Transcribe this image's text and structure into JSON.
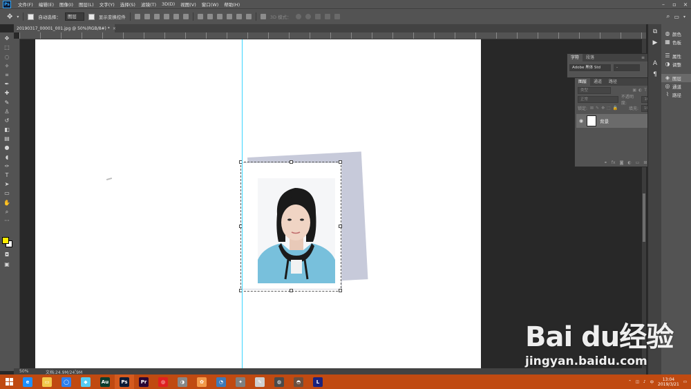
{
  "menu": {
    "logo": "Ps",
    "items": [
      "文件(F)",
      "编辑(E)",
      "图像(I)",
      "图层(L)",
      "文字(Y)",
      "选择(S)",
      "滤镜(T)",
      "3D(D)",
      "视图(V)",
      "窗口(W)",
      "帮助(H)"
    ]
  },
  "options": {
    "auto_select_label": "自动选择：",
    "auto_select_value": "图层",
    "show_transform_label": "显示变换控件",
    "mode_3d_label": "3D 模式："
  },
  "document": {
    "tab_title": "20190317_00001_001.jpg @ 50%(RGB/8#) *",
    "close_glyph": "×"
  },
  "status": {
    "zoom": "50%",
    "doc_size": "文档:24.9M/24.9M"
  },
  "char_panel": {
    "tabs": [
      "字符",
      "段落"
    ],
    "font_family": "Adobe 黑体 Std",
    "font_style": "-"
  },
  "layers_panel": {
    "tabs": [
      "图层",
      "通道",
      "路径"
    ],
    "filter_kind": "类型",
    "blend_mode": "正常",
    "opacity_label": "不透明度:",
    "opacity_value": "100%",
    "lock_label": "锁定:",
    "fill_label": "填充:",
    "fill_value": "100%",
    "layer_name": "背景"
  },
  "dock": {
    "items": [
      {
        "icon": "color-icon",
        "label": "颜色"
      },
      {
        "icon": "swatches-icon",
        "label": "色板"
      },
      {
        "icon": "properties-icon",
        "label": "属性"
      },
      {
        "icon": "adjustments-icon",
        "label": "调整"
      },
      {
        "icon": "layers-icon",
        "label": "图层"
      },
      {
        "icon": "channels-icon",
        "label": "通道"
      },
      {
        "icon": "paths-icon",
        "label": "路径"
      }
    ]
  },
  "taskbar": {
    "apps": [
      {
        "icon": "ie-icon",
        "label": "e",
        "color": "#1e90ff"
      },
      {
        "icon": "file-explorer-icon",
        "label": "▭",
        "color": "#f2c94c"
      },
      {
        "icon": "browser-360-icon",
        "label": "◯",
        "color": "#2f80ed"
      },
      {
        "icon": "baidu-netdisk-icon",
        "label": "◆",
        "color": "#56ccf2"
      },
      {
        "icon": "audition-icon",
        "label": "Au",
        "color": "#0b3d2e"
      },
      {
        "icon": "photoshop-icon",
        "label": "Ps",
        "color": "#0d1c36"
      },
      {
        "icon": "premiere-icon",
        "label": "Pr",
        "color": "#2a0634"
      },
      {
        "icon": "netease-music-icon",
        "label": "◎",
        "color": "#e02020"
      },
      {
        "icon": "app-icon-9",
        "label": "◑",
        "color": "#888888"
      },
      {
        "icon": "app-icon-10",
        "label": "✿",
        "color": "#f2994a"
      },
      {
        "icon": "app-icon-11",
        "label": "◔",
        "color": "#3d7ab8"
      },
      {
        "icon": "app-icon-12",
        "label": "✦",
        "color": "#7f7f7f"
      },
      {
        "icon": "app-icon-13",
        "label": "✎",
        "color": "#cfcfcf"
      },
      {
        "icon": "app-icon-14",
        "label": "◍",
        "color": "#4a4a4a"
      },
      {
        "icon": "app-icon-15",
        "label": "◓",
        "color": "#6b4f3f"
      },
      {
        "icon": "app-icon-16",
        "label": "L",
        "color": "#1a237e"
      }
    ],
    "time": "13:04",
    "date": "2019/3/21"
  },
  "watermark": {
    "logo_text": "Bai du经验",
    "url": "jingyan.baidu.com"
  }
}
